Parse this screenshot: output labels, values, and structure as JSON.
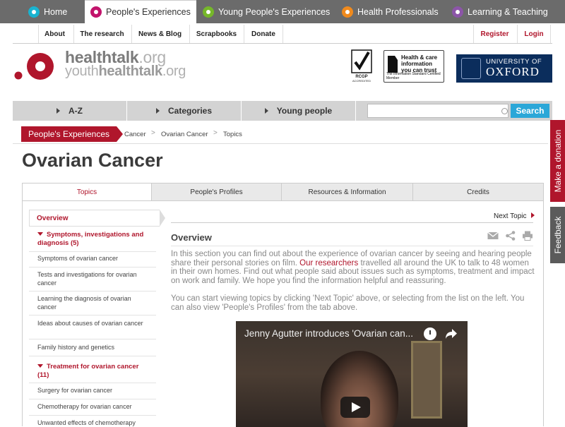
{
  "top_nav": {
    "tabs": [
      {
        "label": "Home",
        "color": "#19b3d0"
      },
      {
        "label": "People's Experiences",
        "color": "#c2146c"
      },
      {
        "label": "Young People's Experiences",
        "color": "#76b72a"
      },
      {
        "label": "Health Professionals",
        "color": "#f08a1d"
      },
      {
        "label": "Learning & Teaching",
        "color": "#8c55a8"
      }
    ],
    "active": "People's Experiences"
  },
  "secondary_nav": {
    "left": [
      "About",
      "The research",
      "News & Blog",
      "Scrapbooks",
      "Donate"
    ],
    "right": [
      "Register",
      "Login"
    ]
  },
  "brand": {
    "line1_a": "healthtalk",
    "line1_b": ".org",
    "line2_a": "youth",
    "line2_b": "healthtalk",
    "line2_c": ".org",
    "rcgp": "RCGP",
    "rcgp_sub": "ACCREDITED",
    "info_standard": "Health & care information you can trust",
    "info_standard_sub": "The Information Standard  Certified Member",
    "oxford_line1": "UNIVERSITY OF",
    "oxford_line2": "OXFORD"
  },
  "main_nav": {
    "items": [
      "A-Z",
      "Categories",
      "Young people"
    ],
    "search_placeholder": "",
    "search_button": "Search"
  },
  "breadcrumb": {
    "section": "People's Experiences",
    "crumbs": [
      "Cancer",
      "Ovarian Cancer",
      "Topics"
    ]
  },
  "page_title": "Ovarian Cancer",
  "tabs": [
    "Topics",
    "People's Profiles",
    "Resources & Information",
    "Credits"
  ],
  "active_tab": "Topics",
  "sidebar": {
    "overview": "Overview",
    "group1": "Symptoms, investigations and diagnosis (5)",
    "group1_items": [
      "Symptoms of ovarian cancer",
      "Tests and investigations for ovarian cancer",
      "Learning the diagnosis of ovarian cancer",
      "Ideas about causes of ovarian cancer",
      "Family history and genetics"
    ],
    "group2": "Treatment for ovarian cancer (11)",
    "group2_items": [
      "Surgery for ovarian cancer",
      "Chemotherapy for ovarian cancer",
      "Unwanted effects of chemotherapy"
    ]
  },
  "content": {
    "next_topic": "Next Topic",
    "heading": "Overview",
    "para1_a": "In this section you can find out about the experience of ovarian cancer by seeing and hearing people share their personal stories on film. ",
    "para1_link": "Our researchers",
    "para1_b": " travelled all around the UK to talk to 48 women in their own homes. Find out what people said about issues such as symptoms, treatment and impact on work and family. We hope you find the information helpful and reassuring.",
    "para2": "You can start viewing topics by clicking 'Next Topic' above, or selecting from the list on the left. You can also view 'People's Profiles' from the tab above.",
    "video_title": "Jenny Agutter introduces 'Ovarian can..."
  },
  "side_tabs": {
    "donate": "Make a donation",
    "feedback": "Feedback"
  },
  "colors": {
    "brand_red": "#b0162c",
    "search_blue": "#2ba7d8",
    "nav_grey": "#6b6b6b"
  }
}
